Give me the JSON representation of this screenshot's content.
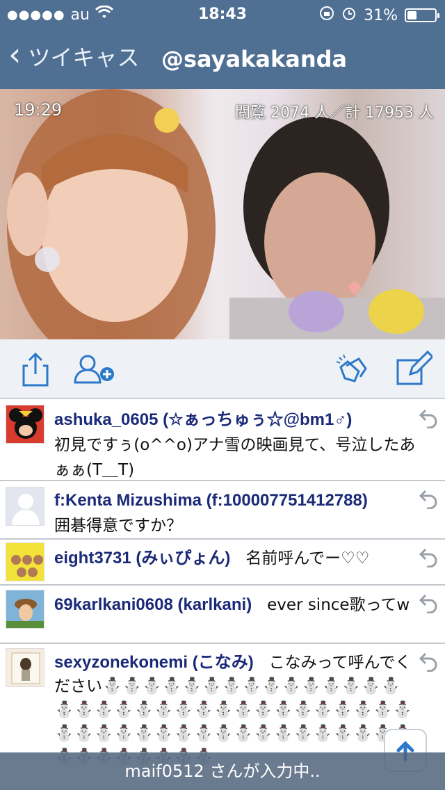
{
  "status": {
    "carrier": "au",
    "time": "18:43",
    "battery_text": "31%",
    "battery_level": 0.31
  },
  "nav": {
    "back_label": "ツイキャス",
    "title": "@sayakakanda"
  },
  "video": {
    "elapsed": "19:29",
    "views": "閲覧 2074 人／計 17953 人"
  },
  "comments": [
    {
      "user": "ashuka_0605 (☆ぁっちゅぅ☆@bm1♂)",
      "text": "初見ですぅ(o^^o)アナ雪の映画見て、号泣したあぁぁ(T＿T)"
    },
    {
      "user": "f:Kenta Mizushima (f:100007751412788)",
      "text": "囲碁得意ですか？"
    },
    {
      "user": "eight3731 (みぃぴょん)",
      "text": "名前呼んでー♡♡"
    },
    {
      "user": "69karlkani0608 (karlkani)",
      "text": "ever since歌ってw"
    },
    {
      "user": "sexyzonekonemi (こなみ)",
      "text": "こなみって呼んでください⛄⛄⛄⛄⛄⛄⛄⛄⛄⛄⛄⛄⛄⛄⛄⛄⛄⛄⛄⛄⛄⛄⛄⛄⛄⛄⛄⛄⛄⛄⛄⛄⛄⛄⛄⛄⛄⛄⛄⛄⛄⛄⛄⛄⛄⛄⛄⛄⛄⛄⛄⛄⛄⛄⛄⛄⛄⛄⛄"
    }
  ],
  "typing": "maif0512 さんが入力中..",
  "colors": {
    "bar": "#4f6f93",
    "accent": "#2c78c9",
    "username": "#1b2a78"
  }
}
